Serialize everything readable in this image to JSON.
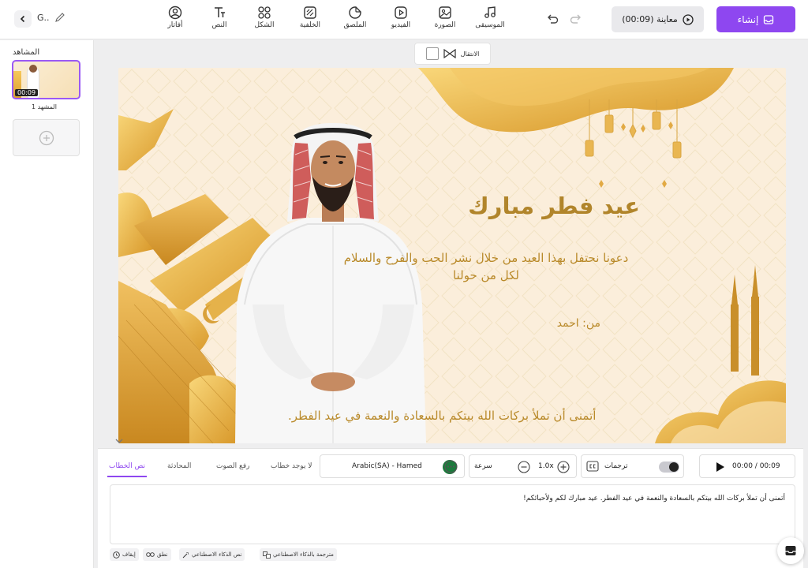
{
  "header": {
    "project_name": "G..",
    "tools": [
      {
        "label": "أفاتار",
        "icon": "avatar-icon"
      },
      {
        "label": "النص",
        "icon": "text-icon"
      },
      {
        "label": "الشكل",
        "icon": "shape-icon"
      },
      {
        "label": "الخلفية",
        "icon": "background-icon"
      },
      {
        "label": "الملصق",
        "icon": "sticker-icon"
      },
      {
        "label": "الفيديو",
        "icon": "video-icon"
      },
      {
        "label": "الصورة",
        "icon": "image-icon"
      },
      {
        "label": "الموسيقى",
        "icon": "music-icon"
      }
    ],
    "preview_label": "معاينة (00:09)",
    "create_label": "إنشاء"
  },
  "scenes": {
    "title": "المشاهد",
    "items": [
      {
        "label": "المشهد 1",
        "duration": "00:09"
      }
    ]
  },
  "transition": {
    "label": "الانتقال"
  },
  "canvas": {
    "headline": "عيد فطر مبارك",
    "paragraph": "دعونا نحتفل بهذا العيد من خلال نشر الحب والفرح والسلام لكل من حولنا",
    "from": "من: احمد",
    "bottom_text": "أتمنى أن تملأ بركات الله بيتكم بالسعادة والنعمة في عيد الفطر."
  },
  "editor": {
    "tabs": [
      {
        "label": "نص الخطاب",
        "active": true
      },
      {
        "label": "المحادثة",
        "active": false
      },
      {
        "label": "رفع الصوت",
        "active": false
      },
      {
        "label": "لا يوجد خطاب",
        "active": false
      }
    ],
    "voice": "Arabic(SA) - Hamed",
    "speed_label": "سرعة",
    "speed_value": "1.0x",
    "captions_label": "ترجمات",
    "captions_on": true,
    "time": "00:00 / 00:09",
    "script": "أتمنى أن تملأ بركات الله بيتكم بالسعادة والنعمة في عيد الفطر. عيد مبارك لكم ولأحبائكم!",
    "buttons": [
      {
        "label": "إيقاف",
        "icon": "clock-icon"
      },
      {
        "label": "نطق",
        "icon": "glasses-icon"
      },
      {
        "label": "نص الذكاء الاصطناعي",
        "icon": "magic-wand-icon"
      },
      {
        "label": "مترجمة بالذكاء الاصطناعي",
        "icon": "translate-icon"
      }
    ]
  },
  "colors": {
    "accent": "#8e47f0",
    "gold_text": "#b98a2a",
    "canvas_bg": "#fbeedb"
  }
}
